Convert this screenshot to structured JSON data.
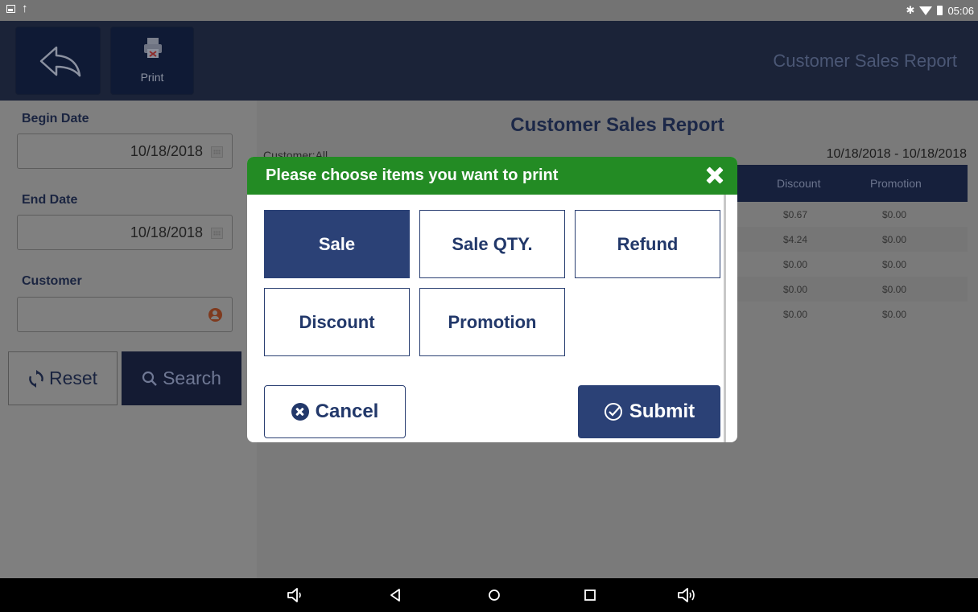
{
  "status_bar": {
    "time": "05:06",
    "bluetooth": "bluetooth-icon",
    "wifi": "wifi-icon",
    "battery": "battery-icon"
  },
  "header": {
    "print_label": "Print",
    "title": "Customer Sales Report"
  },
  "sidebar": {
    "begin_date_label": "Begin Date",
    "begin_date_value": "10/18/2018",
    "end_date_label": "End Date",
    "end_date_value": "10/18/2018",
    "customer_label": "Customer",
    "customer_value": "",
    "reset_label": "Reset",
    "search_label": "Search"
  },
  "report": {
    "title": "Customer Sales Report",
    "customer": "Customer:All",
    "date_range": "10/18/2018 - 10/18/2018",
    "columns": [
      "Discount",
      "Promotion"
    ],
    "rows": [
      [
        "$0.67",
        "$0.00"
      ],
      [
        "$4.24",
        "$0.00"
      ],
      [
        "$0.00",
        "$0.00"
      ],
      [
        "$0.00",
        "$0.00"
      ],
      [
        "$0.00",
        "$0.00"
      ]
    ]
  },
  "modal": {
    "title": "Please choose items you want to print",
    "options": [
      {
        "label": "Sale",
        "selected": true
      },
      {
        "label": "Sale QTY.",
        "selected": false
      },
      {
        "label": "Refund",
        "selected": false
      },
      {
        "label": "Discount",
        "selected": false
      },
      {
        "label": "Promotion",
        "selected": false
      }
    ],
    "cancel_label": "Cancel",
    "submit_label": "Submit"
  },
  "colors": {
    "accent": "#2b4176",
    "modal_header": "#238b24",
    "header_bg": "#1b2338"
  }
}
